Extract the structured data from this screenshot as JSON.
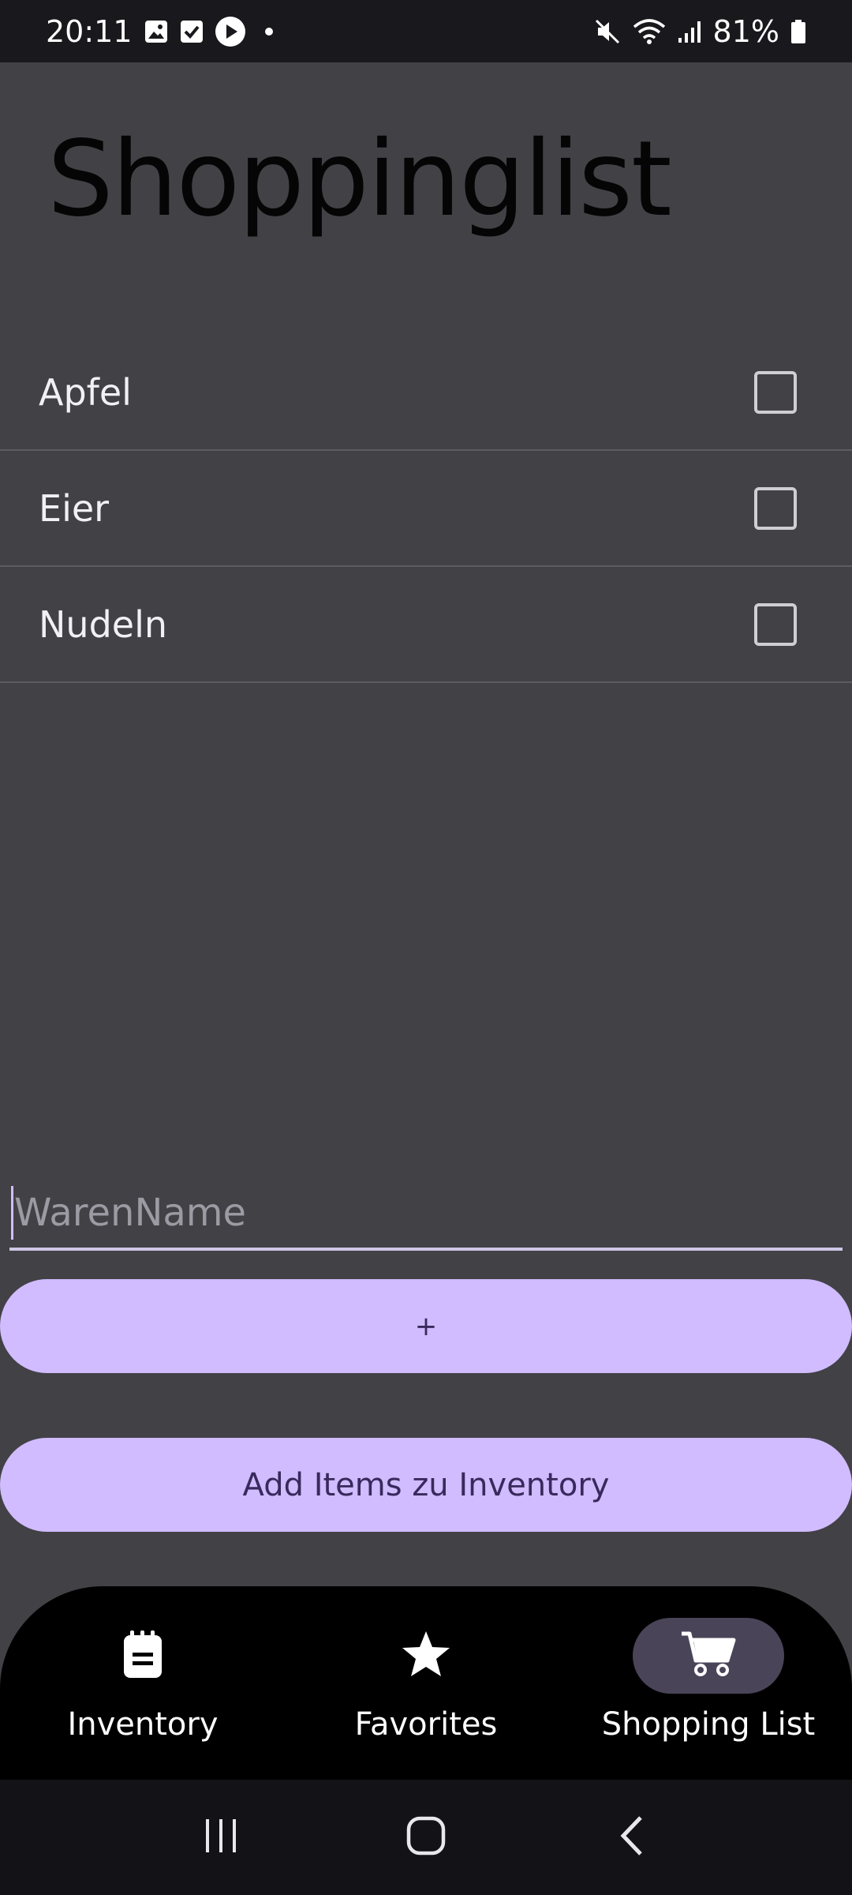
{
  "status_bar": {
    "time": "20:11",
    "battery": "81%",
    "left_icons": [
      "gallery-icon",
      "checkbox-notification-icon",
      "play-icon",
      "dot-icon"
    ],
    "right_icons": [
      "mute-icon",
      "wifi-icon",
      "signal-icon",
      "battery-icon"
    ]
  },
  "page": {
    "title": "Shoppinglist"
  },
  "shopping_items": [
    {
      "label": "Apfel",
      "checked": false
    },
    {
      "label": "Eier",
      "checked": false
    },
    {
      "label": "Nudeln",
      "checked": false
    }
  ],
  "input": {
    "placeholder": "WarenName",
    "value": ""
  },
  "buttons": {
    "add_label": "+",
    "add_to_inventory_label": "Add Items zu Inventory"
  },
  "bottom_nav": {
    "items": [
      {
        "label": "Inventory",
        "icon": "notepad-icon",
        "active": false
      },
      {
        "label": "Favorites",
        "icon": "star-icon",
        "active": false
      },
      {
        "label": "Shopping List",
        "icon": "cart-icon",
        "active": true
      }
    ]
  },
  "colors": {
    "background": "#424146",
    "accent": "#d0bcfe",
    "accent_text": "#39295c",
    "nav_background": "#000000",
    "nav_active_indicator": "#4a4458"
  }
}
